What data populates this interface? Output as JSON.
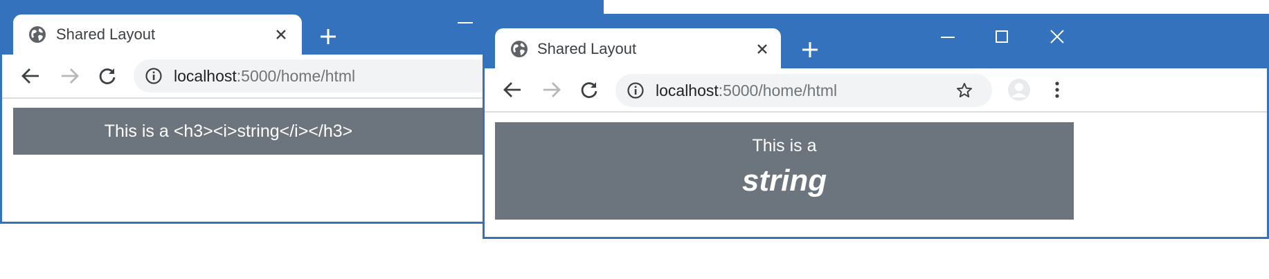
{
  "windows": [
    {
      "tab_title": "Shared Layout",
      "url_host": "localhost",
      "url_rest": ":5000/home/html",
      "content_text": "This is a <h3><i>string</i></h3>"
    },
    {
      "tab_title": "Shared Layout",
      "url_host": "localhost",
      "url_rest": ":5000/home/html",
      "content_line1": "This is a",
      "content_line2": "string"
    }
  ],
  "colors": {
    "titlebar": "#3572bd",
    "banner": "#6c757d"
  }
}
